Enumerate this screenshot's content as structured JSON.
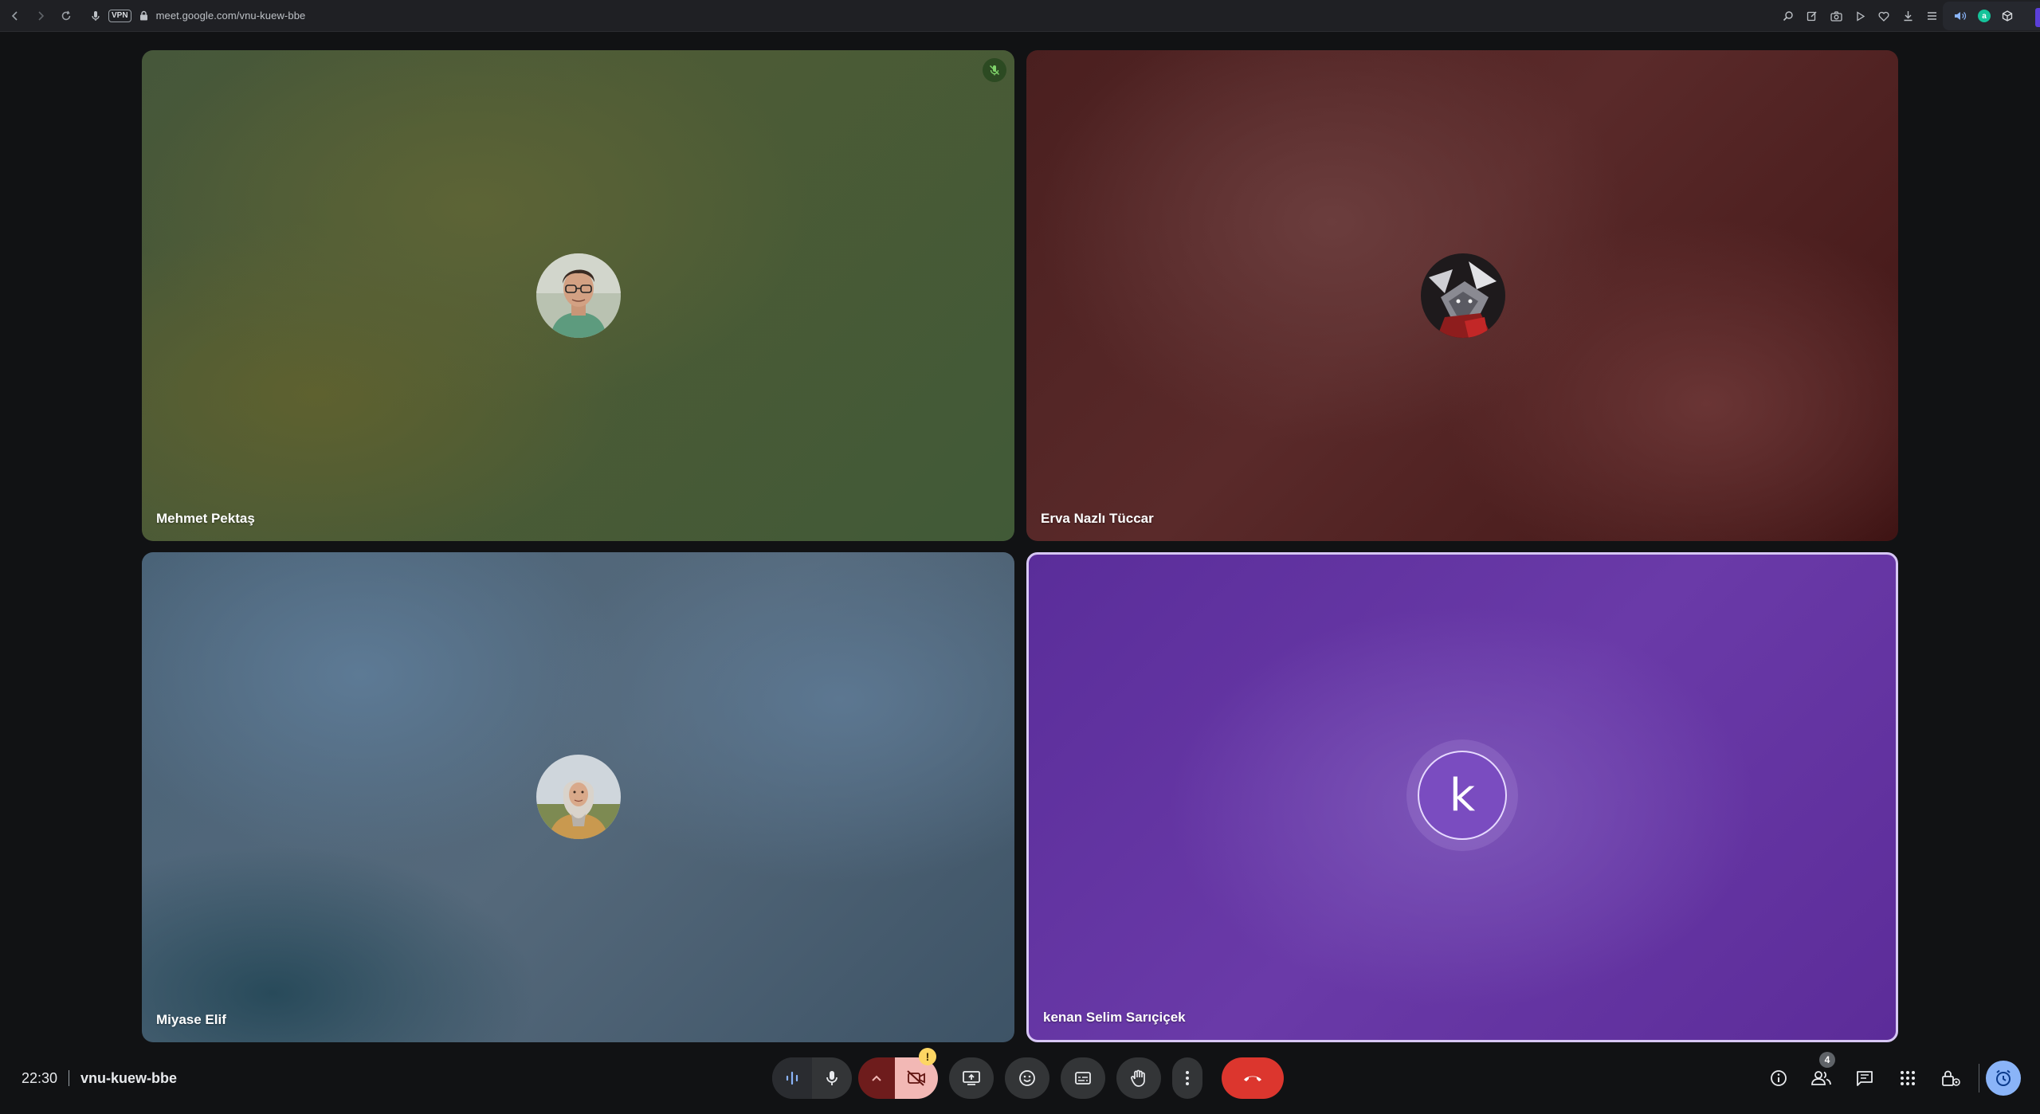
{
  "browser": {
    "url": "meet.google.com/vnu-kuew-bbe",
    "vpn_label": "VPN"
  },
  "tiles": [
    {
      "name": "Mehmet Pektaş",
      "avatar": "photo-avatar",
      "muted": true
    },
    {
      "name": "Erva Nazlı Tüccar",
      "avatar": "photo-avatar"
    },
    {
      "name": "Miyase Elif",
      "avatar": "photo-avatar"
    },
    {
      "name": "kenan Selim Sarıçiçek",
      "avatar_initial": "k",
      "active_speaker": true,
      "avatar_color": "#7a4cc0"
    }
  ],
  "meeting": {
    "time": "22:30",
    "code": "vnu-kuew-bbe"
  },
  "controls": {
    "camera_warning": "!",
    "people_count": "4"
  },
  "colors": {
    "leave": "#dc362e",
    "camera_off_bg": "#f2b8b5",
    "active_border": "#d7c7f5",
    "clock_btn": "#8ab4f8"
  }
}
